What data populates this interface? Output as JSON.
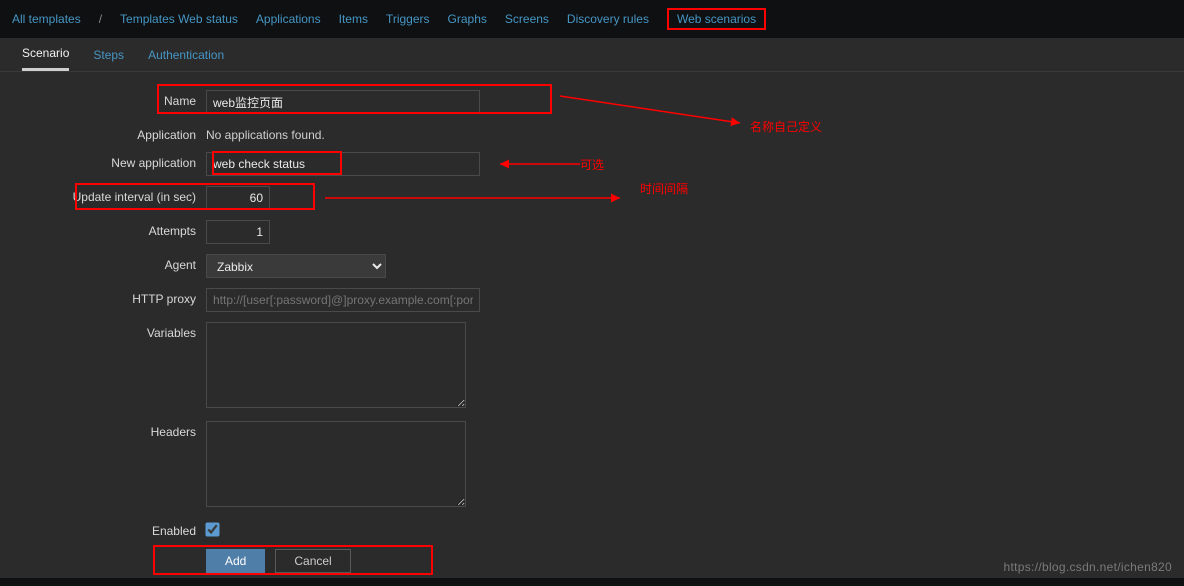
{
  "nav": {
    "all_templates": "All templates",
    "template_name": "Templates Web status",
    "applications": "Applications",
    "items": "Items",
    "triggers": "Triggers",
    "graphs": "Graphs",
    "screens": "Screens",
    "discovery": "Discovery rules",
    "web_scenarios": "Web scenarios"
  },
  "tabs": {
    "scenario": "Scenario",
    "steps": "Steps",
    "authentication": "Authentication"
  },
  "labels": {
    "name": "Name",
    "application": "Application",
    "new_application": "New application",
    "update_interval": "Update interval (in sec)",
    "attempts": "Attempts",
    "agent": "Agent",
    "http_proxy": "HTTP proxy",
    "variables": "Variables",
    "headers": "Headers",
    "enabled": "Enabled"
  },
  "values": {
    "name": "web监控页面",
    "application_none": "No applications found.",
    "new_application": "web check status",
    "update_interval": "60",
    "attempts": "1",
    "agent": "Zabbix",
    "http_proxy_placeholder": "http://[user[:password]@]proxy.example.com[:port]",
    "variables": "",
    "headers": ""
  },
  "buttons": {
    "add": "Add",
    "cancel": "Cancel"
  },
  "annotations": {
    "name_note": "名称自己定义",
    "optional": "可选",
    "interval_note": "时间间隔"
  },
  "watermark": "https://blog.csdn.net/ichen820"
}
